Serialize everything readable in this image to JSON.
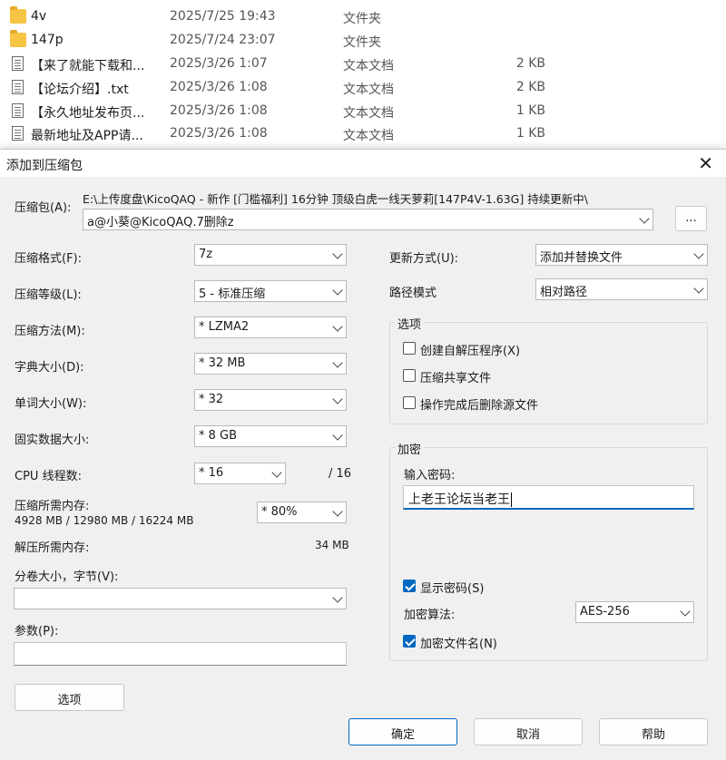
{
  "files": [
    {
      "icon": "folder-icon",
      "name": "4v",
      "date": "2025/7/25 19:43",
      "type": "文件夹",
      "size": ""
    },
    {
      "icon": "folder-icon",
      "name": "147p",
      "date": "2025/7/24 23:07",
      "type": "文件夹",
      "size": ""
    },
    {
      "icon": "text-file-icon",
      "name": "【来了就能下载和...",
      "date": "2025/3/26 1:07",
      "type": "文本文档",
      "size": "2 KB"
    },
    {
      "icon": "text-file-icon",
      "name": "【论坛介绍】.txt",
      "date": "2025/3/26 1:08",
      "type": "文本文档",
      "size": "2 KB"
    },
    {
      "icon": "text-file-icon",
      "name": "【永久地址发布页...",
      "date": "2025/3/26 1:08",
      "type": "文本文档",
      "size": "1 KB"
    },
    {
      "icon": "text-file-icon",
      "name": "最新地址及APP请...",
      "date": "2025/3/26 1:08",
      "type": "文本文档",
      "size": "1 KB"
    }
  ],
  "dialog": {
    "title": "添加到压缩包",
    "archive_label": "压缩包(A):",
    "archive_path": "E:\\上传度盘\\KicoQAQ - 新作 [门槛福利] 16分钟 顶级白虎一线天萝莉[147P4V-1.63G] 持续更新中\\",
    "archive_name": "a@小葵@KicoQAQ.7删除z",
    "browse_label": "...",
    "format_label": "压缩格式(F):",
    "format_value": "7z",
    "level_label": "压缩等级(L):",
    "level_value": "5 - 标准压缩",
    "method_label": "压缩方法(M):",
    "method_value": "* LZMA2",
    "dict_label": "字典大小(D):",
    "dict_value": "* 32 MB",
    "word_label": "单词大小(W):",
    "word_value": "* 32",
    "solid_label": "固实数据大小:",
    "solid_value": "* 8 GB",
    "threads_label": "CPU 线程数:",
    "threads_value": "* 16",
    "threads_max": "/ 16",
    "mem_label": "压缩所需内存:",
    "mem_values": "4928 MB / 12980 MB / 16224 MB",
    "mem_pct": "* 80%",
    "decomp_label": "解压所需内存:",
    "decomp_value": "34 MB",
    "volume_label": "分卷大小，字节(V):",
    "volume_value": "",
    "params_label": "参数(P):",
    "params_value": "",
    "options_button": "选项",
    "update_label": "更新方式(U):",
    "update_value": "添加并替换文件",
    "path_label": "路径模式",
    "path_value": "相对路径",
    "options_group": "选项",
    "opt_sfx": "创建自解压程序(X)",
    "opt_shared": "压缩共享文件",
    "opt_delete": "操作完成后删除源文件",
    "encrypt_group": "加密",
    "password_label": "输入密码:",
    "password_value": "上老王论坛当老王",
    "show_password": "显示密码(S)",
    "enc_method_label": "加密算法:",
    "enc_method_value": "AES-256",
    "enc_names": "加密文件名(N)",
    "ok": "确定",
    "cancel": "取消",
    "help": "帮助"
  },
  "colors": {
    "accent": "#0067c0",
    "dialog_bg": "#f0f0f0",
    "folder": "#f7c544"
  }
}
